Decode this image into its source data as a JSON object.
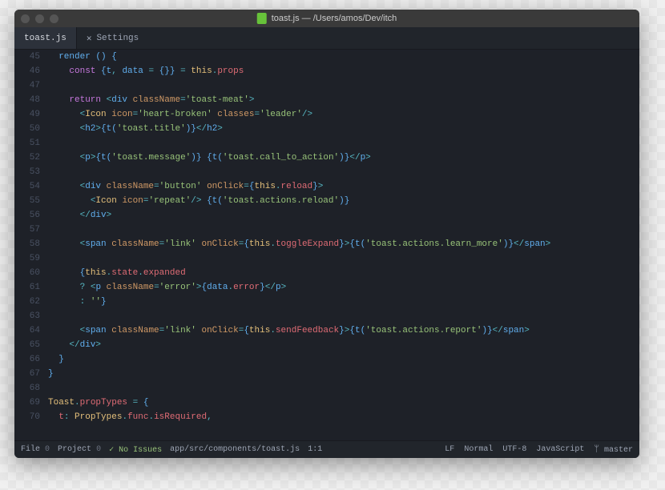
{
  "window": {
    "title": "toast.js — /Users/amos/Dev/itch"
  },
  "tabs": {
    "active": "toast.js",
    "settings_label": "Settings"
  },
  "gutter": {
    "start": 45,
    "end": 70
  },
  "code_lines": [
    [
      [
        "deflt",
        "  "
      ],
      [
        "fn",
        "render"
      ],
      [
        "deflt",
        " () {"
      ]
    ],
    [
      [
        "deflt",
        "    "
      ],
      [
        "kw",
        "const"
      ],
      [
        "deflt",
        " {t"
      ],
      [
        "op",
        ","
      ],
      [
        "deflt",
        " data "
      ],
      [
        "op",
        "="
      ],
      [
        "deflt",
        " {}} "
      ],
      [
        "op",
        "="
      ],
      [
        "deflt",
        " "
      ],
      [
        "this",
        "this"
      ],
      [
        "op",
        "."
      ],
      [
        "prop",
        "props"
      ]
    ],
    [],
    [
      [
        "deflt",
        "    "
      ],
      [
        "kw",
        "return"
      ],
      [
        "deflt",
        " "
      ],
      [
        "op",
        "<"
      ],
      [
        "deflt",
        "div "
      ],
      [
        "attr-name",
        "className"
      ],
      [
        "op",
        "="
      ],
      [
        "str",
        "'toast-meat'"
      ],
      [
        "op",
        ">"
      ]
    ],
    [
      [
        "deflt",
        "      "
      ],
      [
        "op",
        "<"
      ],
      [
        "obj",
        "Icon"
      ],
      [
        "deflt",
        " "
      ],
      [
        "attr-name",
        "icon"
      ],
      [
        "op",
        "="
      ],
      [
        "str",
        "'heart-broken'"
      ],
      [
        "deflt",
        " "
      ],
      [
        "attr-name",
        "classes"
      ],
      [
        "op",
        "="
      ],
      [
        "str",
        "'leader'"
      ],
      [
        "op",
        "/>"
      ]
    ],
    [
      [
        "deflt",
        "      "
      ],
      [
        "op",
        "<"
      ],
      [
        "deflt",
        "h2"
      ],
      [
        "op",
        ">"
      ],
      [
        "deflt",
        "{"
      ],
      [
        "fn",
        "t"
      ],
      [
        "deflt",
        "("
      ],
      [
        "str",
        "'toast.title'"
      ],
      [
        "deflt",
        ")}"
      ],
      [
        "op",
        "</"
      ],
      [
        "deflt",
        "h2"
      ],
      [
        "op",
        ">"
      ]
    ],
    [],
    [
      [
        "deflt",
        "      "
      ],
      [
        "op",
        "<"
      ],
      [
        "deflt",
        "p"
      ],
      [
        "op",
        ">"
      ],
      [
        "deflt",
        "{"
      ],
      [
        "fn",
        "t"
      ],
      [
        "deflt",
        "("
      ],
      [
        "str",
        "'toast.message'"
      ],
      [
        "deflt",
        ")} {"
      ],
      [
        "fn",
        "t"
      ],
      [
        "deflt",
        "("
      ],
      [
        "str",
        "'toast.call_to_action'"
      ],
      [
        "deflt",
        ")}"
      ],
      [
        "op",
        "</"
      ],
      [
        "deflt",
        "p"
      ],
      [
        "op",
        ">"
      ]
    ],
    [],
    [
      [
        "deflt",
        "      "
      ],
      [
        "op",
        "<"
      ],
      [
        "deflt",
        "div "
      ],
      [
        "attr-name",
        "className"
      ],
      [
        "op",
        "="
      ],
      [
        "str",
        "'button'"
      ],
      [
        "deflt",
        " "
      ],
      [
        "attr-name",
        "onClick"
      ],
      [
        "op",
        "="
      ],
      [
        "deflt",
        "{"
      ],
      [
        "this",
        "this"
      ],
      [
        "op",
        "."
      ],
      [
        "prop",
        "reload"
      ],
      [
        "deflt",
        "}"
      ],
      [
        "op",
        ">"
      ]
    ],
    [
      [
        "deflt",
        "        "
      ],
      [
        "op",
        "<"
      ],
      [
        "obj",
        "Icon"
      ],
      [
        "deflt",
        " "
      ],
      [
        "attr-name",
        "icon"
      ],
      [
        "op",
        "="
      ],
      [
        "str",
        "'repeat'"
      ],
      [
        "op",
        "/>"
      ],
      [
        "deflt",
        " {"
      ],
      [
        "fn",
        "t"
      ],
      [
        "deflt",
        "("
      ],
      [
        "str",
        "'toast.actions.reload'"
      ],
      [
        "deflt",
        ")}"
      ]
    ],
    [
      [
        "deflt",
        "      "
      ],
      [
        "op",
        "</"
      ],
      [
        "deflt",
        "div"
      ],
      [
        "op",
        ">"
      ]
    ],
    [],
    [
      [
        "deflt",
        "      "
      ],
      [
        "op",
        "<"
      ],
      [
        "deflt",
        "span "
      ],
      [
        "attr-name",
        "className"
      ],
      [
        "op",
        "="
      ],
      [
        "str",
        "'link'"
      ],
      [
        "deflt",
        " "
      ],
      [
        "attr-name",
        "onClick"
      ],
      [
        "op",
        "="
      ],
      [
        "deflt",
        "{"
      ],
      [
        "this",
        "this"
      ],
      [
        "op",
        "."
      ],
      [
        "prop",
        "toggleExpand"
      ],
      [
        "deflt",
        "}"
      ],
      [
        "op",
        ">"
      ],
      [
        "deflt",
        "{"
      ],
      [
        "fn",
        "t"
      ],
      [
        "deflt",
        "("
      ],
      [
        "str",
        "'toast.actions.learn_more'"
      ],
      [
        "deflt",
        ")}"
      ],
      [
        "op",
        "</"
      ],
      [
        "deflt",
        "span"
      ],
      [
        "op",
        ">"
      ]
    ],
    [],
    [
      [
        "deflt",
        "      {"
      ],
      [
        "this",
        "this"
      ],
      [
        "op",
        "."
      ],
      [
        "prop",
        "state"
      ],
      [
        "op",
        "."
      ],
      [
        "prop",
        "expanded"
      ]
    ],
    [
      [
        "deflt",
        "      "
      ],
      [
        "op",
        "?"
      ],
      [
        "deflt",
        " "
      ],
      [
        "op",
        "<"
      ],
      [
        "deflt",
        "p "
      ],
      [
        "attr-name",
        "className"
      ],
      [
        "op",
        "="
      ],
      [
        "str",
        "'error'"
      ],
      [
        "op",
        ">"
      ],
      [
        "deflt",
        "{data"
      ],
      [
        "op",
        "."
      ],
      [
        "prop",
        "error"
      ],
      [
        "deflt",
        "}"
      ],
      [
        "op",
        "</"
      ],
      [
        "deflt",
        "p"
      ],
      [
        "op",
        ">"
      ]
    ],
    [
      [
        "deflt",
        "      "
      ],
      [
        "op",
        ":"
      ],
      [
        "deflt",
        " "
      ],
      [
        "str",
        "''"
      ],
      [
        "deflt",
        "}"
      ]
    ],
    [],
    [
      [
        "deflt",
        "      "
      ],
      [
        "op",
        "<"
      ],
      [
        "deflt",
        "span "
      ],
      [
        "attr-name",
        "className"
      ],
      [
        "op",
        "="
      ],
      [
        "str",
        "'link'"
      ],
      [
        "deflt",
        " "
      ],
      [
        "attr-name",
        "onClick"
      ],
      [
        "op",
        "="
      ],
      [
        "deflt",
        "{"
      ],
      [
        "this",
        "this"
      ],
      [
        "op",
        "."
      ],
      [
        "prop",
        "sendFeedback"
      ],
      [
        "deflt",
        "}"
      ],
      [
        "op",
        ">"
      ],
      [
        "deflt",
        "{"
      ],
      [
        "fn",
        "t"
      ],
      [
        "deflt",
        "("
      ],
      [
        "str",
        "'toast.actions.report'"
      ],
      [
        "deflt",
        ")}"
      ],
      [
        "op",
        "</"
      ],
      [
        "deflt",
        "span"
      ],
      [
        "op",
        ">"
      ]
    ],
    [
      [
        "deflt",
        "    "
      ],
      [
        "op",
        "</"
      ],
      [
        "deflt",
        "div"
      ],
      [
        "op",
        ">"
      ]
    ],
    [
      [
        "deflt",
        "  }"
      ]
    ],
    [
      [
        "deflt",
        "}"
      ]
    ],
    [],
    [
      [
        "obj",
        "Toast"
      ],
      [
        "op",
        "."
      ],
      [
        "prop",
        "propTypes"
      ],
      [
        "deflt",
        " "
      ],
      [
        "op",
        "="
      ],
      [
        "deflt",
        " {"
      ]
    ],
    [
      [
        "deflt",
        "  "
      ],
      [
        "prop",
        "t"
      ],
      [
        "op",
        ":"
      ],
      [
        "deflt",
        " "
      ],
      [
        "obj",
        "PropTypes"
      ],
      [
        "op",
        "."
      ],
      [
        "prop",
        "func"
      ],
      [
        "op",
        "."
      ],
      [
        "prop",
        "isRequired"
      ],
      [
        "op",
        ","
      ]
    ]
  ],
  "status": {
    "file_label": "File",
    "file_count": "0",
    "project_label": "Project",
    "project_count": "0",
    "issues": "No Issues",
    "path": "app/src/components/toast.js",
    "cursor": "1:1",
    "line_ending": "LF",
    "mode": "Normal",
    "encoding": "UTF-8",
    "language": "JavaScript",
    "branch": "master"
  }
}
